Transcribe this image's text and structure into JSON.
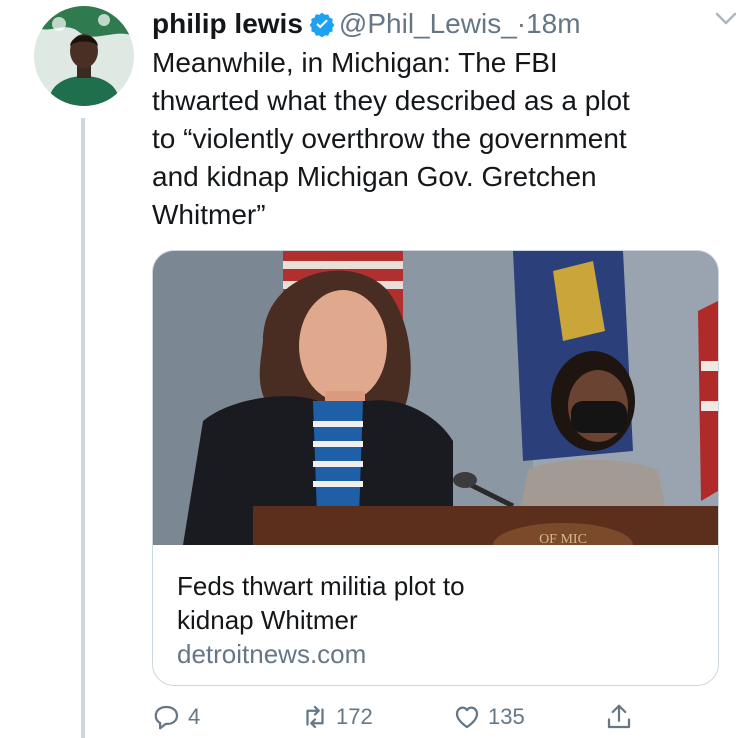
{
  "tweet": {
    "display_name": "philip lewis",
    "handle": "@Phil_Lewis_",
    "separator": "·",
    "time": "18m",
    "text": "Meanwhile, in Michigan: The FBI\nthwarted what they described as a plot\nto “violently overthrow the government\nand kidnap Michigan Gov. Gretchen\nWhitmer”"
  },
  "card": {
    "title_line1": "Feds thwart militia plot to",
    "title_line2": "kidnap Whitmer",
    "domain": "detroitnews.com",
    "podium_text": "OF MIC"
  },
  "actions": {
    "replies": "4",
    "retweets": "172",
    "likes": "135"
  },
  "colors": {
    "verified": "#1da1f2",
    "secondary_text": "#657786",
    "border": "#ccd6dd"
  }
}
